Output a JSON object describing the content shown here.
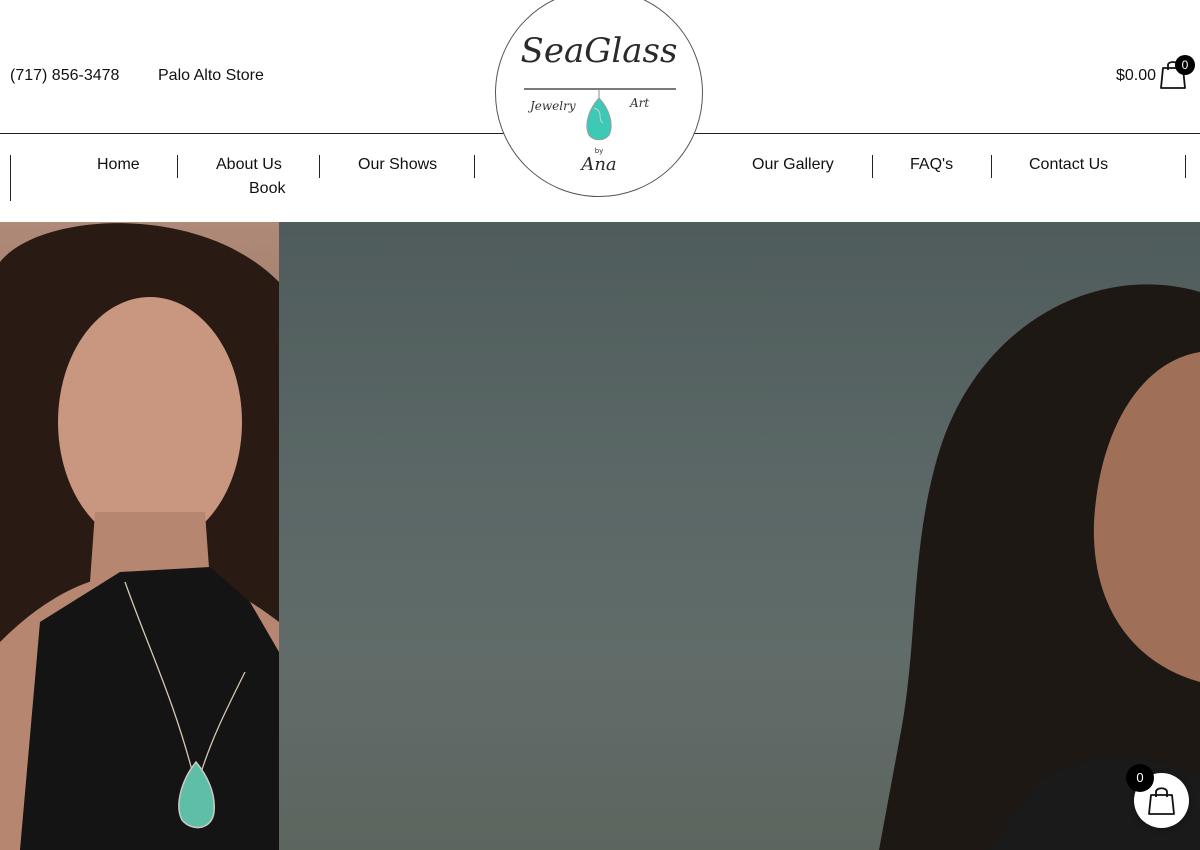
{
  "header": {
    "phone": "(717) 856-3478",
    "store_link": "Palo Alto Store",
    "logo": {
      "brand": "SeaGlass",
      "left_word": "Jewelry",
      "right_word": "Art",
      "by": "by",
      "signature": "Ana"
    },
    "cart": {
      "total": "$0.00",
      "count": "0"
    }
  },
  "nav": {
    "left": [
      "Home",
      "About Us",
      "Our Shows",
      "Book"
    ],
    "right": [
      "Our Gallery",
      "FAQ's",
      "Contact Us"
    ]
  },
  "floating_cart": {
    "count": "0"
  },
  "colors": {
    "accent_turquoise": "#3cc9b5",
    "text": "#111111",
    "hero_right_bg": "#5a6766"
  },
  "icons": {
    "cart": "shopping-bag-icon"
  }
}
